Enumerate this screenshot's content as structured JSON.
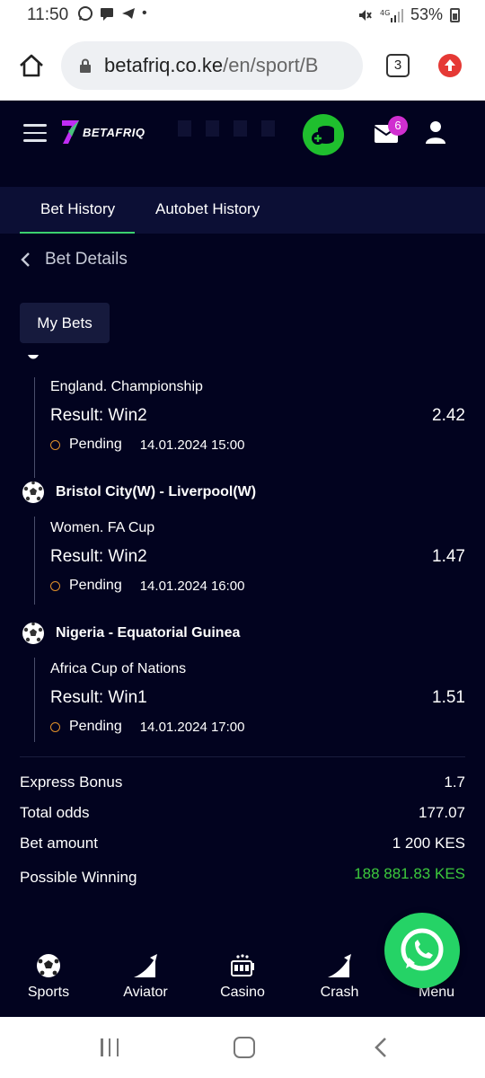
{
  "status_bar": {
    "time": "11:50",
    "battery": "53%",
    "icons": [
      "whatsapp-icon",
      "message-icon",
      "telegram-icon",
      "dot-icon"
    ]
  },
  "browser": {
    "url_domain": "betafriq.co.ke",
    "url_path": "/en/sport/B",
    "tab_count": "3"
  },
  "header": {
    "logo_text": "BETAFRIQ",
    "mail_badge": "6"
  },
  "tabs": [
    "Bet History",
    "Autobet History"
  ],
  "back_label": "Bet Details",
  "my_bets_label": "My Bets",
  "bets": [
    {
      "match": "",
      "league": "England. Championship",
      "result": "Result: Win2",
      "odd": "2.42",
      "status": "Pending",
      "date": "14.01.2024 15:00"
    },
    {
      "match": "Bristol City(W) - Liverpool(W)",
      "league": "Women. FA Cup",
      "result": "Result: Win2",
      "odd": "1.47",
      "status": "Pending",
      "date": "14.01.2024 16:00"
    },
    {
      "match": "Nigeria - Equatorial Guinea",
      "league": "Africa Cup of Nations",
      "result": "Result: Win1",
      "odd": "1.51",
      "status": "Pending",
      "date": "14.01.2024 17:00"
    }
  ],
  "summary": {
    "express_bonus_label": "Express Bonus",
    "express_bonus_value": "1.7",
    "total_odds_label": "Total odds",
    "total_odds_value": "177.07",
    "bet_amount_label": "Bet amount",
    "bet_amount_value": "1 200 KES",
    "possible_winning_label": "Possible Winning",
    "possible_winning_value": "188 881.83 KES"
  },
  "bottom_nav": [
    "Sports",
    "Aviator",
    "Casino",
    "Crash",
    "Menu"
  ],
  "colors": {
    "background": "#02031f",
    "accent_green": "#3cc93c",
    "pending_dot": "#e0902a",
    "badge": "#d02fd0"
  }
}
